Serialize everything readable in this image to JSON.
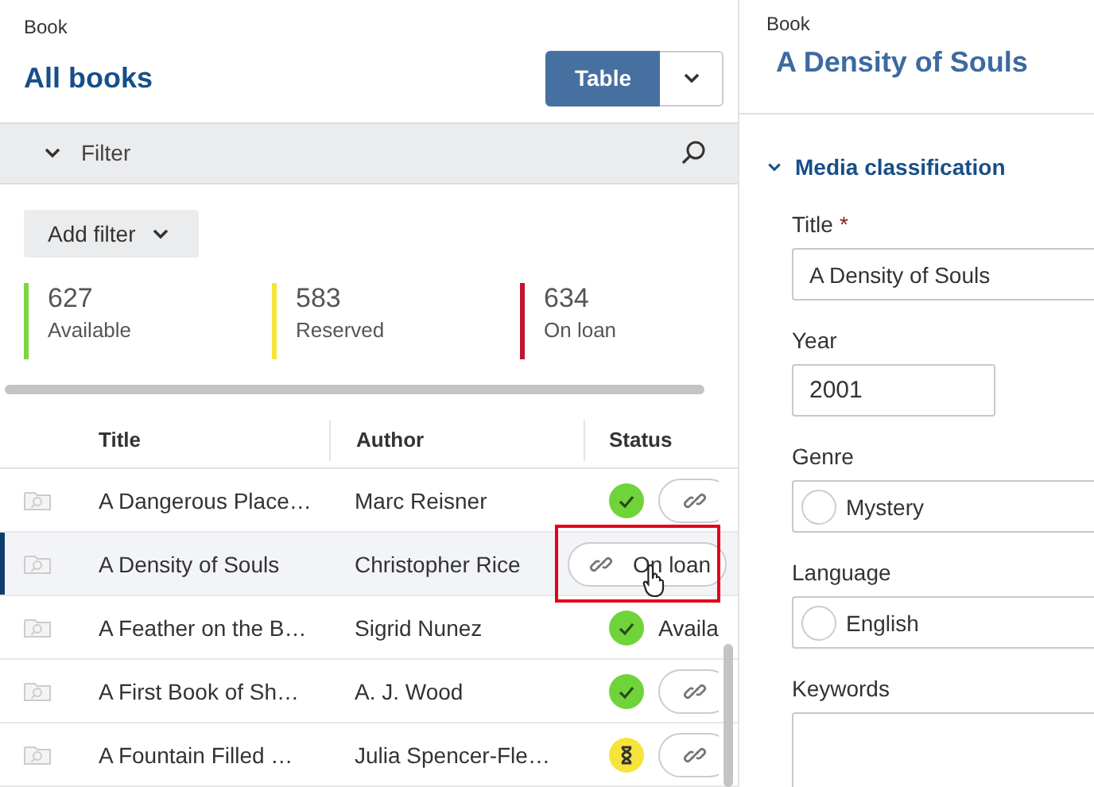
{
  "list": {
    "breadcrumb": "Book",
    "title": "All books",
    "view_switch": {
      "label": "Table",
      "selected": true
    },
    "filter": {
      "label": "Filter",
      "expanded": true
    },
    "add_filter": "Add filter",
    "stats": [
      {
        "count": "627",
        "label": "Available",
        "color": "#7ed63f"
      },
      {
        "count": "583",
        "label": "Reserved",
        "color": "#f5e33c"
      },
      {
        "count": "634",
        "label": "On loan",
        "color": "#c0152f"
      }
    ],
    "table": {
      "columns": [
        "Title",
        "Author",
        "Status"
      ],
      "rows": [
        {
          "title": "A Dangerous Place…",
          "author": "Marc Reisner",
          "selected": false,
          "highlighted": false,
          "indicator": {
            "kind": "available"
          },
          "action": {
            "kind": "link"
          }
        },
        {
          "title": "A Density of Souls",
          "author": "Christopher Rice",
          "selected": true,
          "highlighted": true,
          "action": {
            "kind": "link-label",
            "label": "On loan"
          }
        },
        {
          "title": "A Feather on the B…",
          "author": "Sigrid Nunez",
          "selected": false,
          "highlighted": false,
          "indicator": {
            "kind": "available"
          },
          "action": {
            "kind": "text",
            "label": "Availa"
          }
        },
        {
          "title": "A First Book of Sh…",
          "author": "A. J. Wood",
          "selected": false,
          "highlighted": false,
          "indicator": {
            "kind": "available"
          },
          "action": {
            "kind": "link"
          }
        },
        {
          "title": "A Fountain Filled …",
          "author": "Julia Spencer-Fle…",
          "selected": false,
          "highlighted": false,
          "indicator": {
            "kind": "reserved"
          },
          "action": {
            "kind": "link"
          }
        }
      ]
    }
  },
  "detail": {
    "breadcrumb": "Book",
    "title": "A Density of Souls",
    "section": {
      "title": "Media classification",
      "expanded": true,
      "fields": [
        {
          "kind": "text",
          "label": "Title",
          "required_mark": "*",
          "value": "A Density of Souls"
        },
        {
          "kind": "short",
          "label": "Year",
          "value": "2001"
        },
        {
          "kind": "choice",
          "label": "Genre",
          "value": "Mystery"
        },
        {
          "kind": "choice",
          "label": "Language",
          "value": "English"
        },
        {
          "kind": "area",
          "label": "Keywords"
        }
      ]
    }
  }
}
